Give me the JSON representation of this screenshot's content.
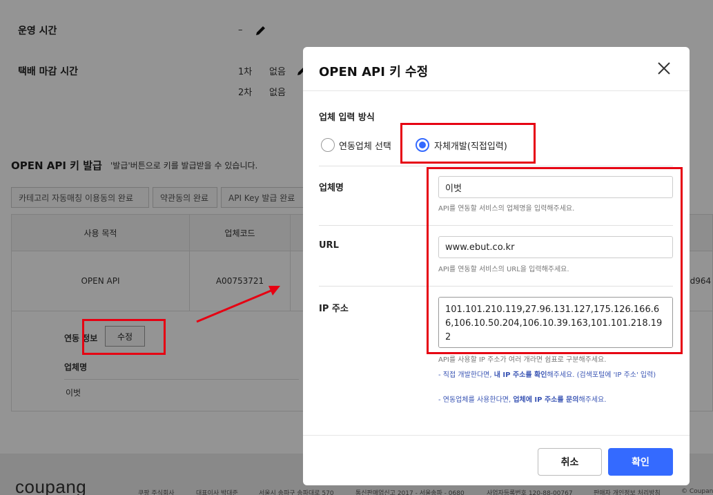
{
  "page": {
    "operating_hours_label": "운영 시간",
    "operating_hours_value": "–",
    "cutoff_label": "택배 마감 시간",
    "cutoff_rows": [
      {
        "round": "1차",
        "value": "없음"
      },
      {
        "round": "2차",
        "value": "없음"
      }
    ],
    "api_section_title": "OPEN API 키 발급",
    "api_section_desc": "'발급'버튼으로 키를 발급받을 수 있습니다.",
    "status_tags": [
      "카테고리 자동매칭 이용동의 완료",
      "약관동의 완료",
      "API Key 발급 완료"
    ],
    "table": {
      "headers": [
        "사용 목적",
        "업체코드"
      ],
      "row": {
        "purpose": "OPEN API",
        "code": "A00753721",
        "truncated": "dd964"
      }
    },
    "link_info_label": "연동 정보",
    "edit_button": "수정",
    "vendor_name_label": "업체명",
    "vendor_name_value": "이벗"
  },
  "footer": {
    "logo": "coupang",
    "items": [
      "쿠팡 주식회사",
      "대표이사 박대준",
      "서울시 송파구 송파대로 570",
      "통신판매업신고 2017 - 서울송파 - 0680",
      "사업자등록번호 120-88-00767",
      "판매자 개인정보 처리방침",
      "© Coupan"
    ]
  },
  "modal": {
    "title": "OPEN API 키 수정",
    "input_method_label": "업체 입력 방식",
    "options": [
      "연동업체 선택",
      "자체개발(직접입력)"
    ],
    "selected_option": "자체개발(직접입력)",
    "vendor": {
      "label": "업체명",
      "value": "이벗",
      "hint": "API를 연동할 서비스의 업체명을 입력해주세요."
    },
    "url": {
      "label": "URL",
      "value": "www.ebut.co.kr",
      "hint": "API를 연동할 서비스의 URL을 입력해주세요."
    },
    "ip": {
      "label": "IP 주소",
      "value": "101.101.210.119,27.96.131.127,175.126.166.66,106.10.50.204,106.10.39.163,101.101.218.192",
      "hint": "API를 사용할 IP 주소가 여러 개라면 쉼표로 구분해주세요.",
      "note1_prefix": "- 직접 개발한다면, ",
      "note1_bold": "내 IP 주소를 확인",
      "note1_suffix": "해주세요. (검색포털에 'IP 주소' 입력)",
      "note2_prefix": "- 연동업체를 사용한다면, ",
      "note2_bold": "업체에 IP 주소를 문의",
      "note2_suffix": "해주세요."
    },
    "cancel_label": "취소",
    "confirm_label": "확인"
  },
  "colors": {
    "accent": "#346aff",
    "annotation": "#e60012",
    "note_text": "#3a55b4"
  }
}
